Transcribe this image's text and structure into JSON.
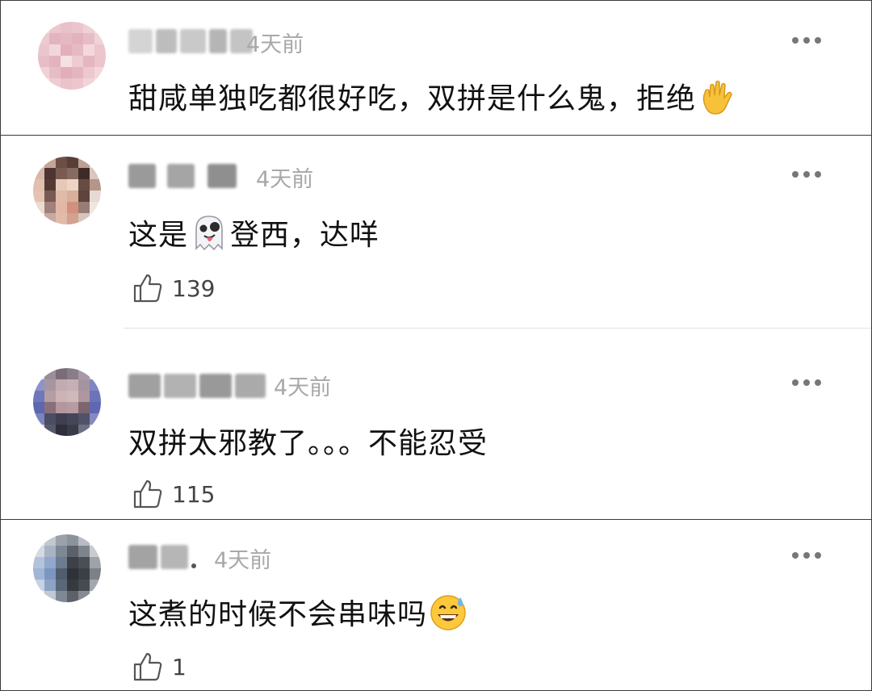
{
  "comments": [
    {
      "time": "4天前",
      "text": "甜咸单独吃都很好吃，双拼是什么鬼，拒绝",
      "emoji": "raised-hand",
      "likes": null
    },
    {
      "time": "4天前",
      "text_before": "这是",
      "emoji": "ghost-tongue",
      "text_after": "登西，达咩",
      "likes": "139"
    },
    {
      "time": "4天前",
      "text": "双拼太邪教了。。。不能忍受",
      "likes": "115"
    },
    {
      "time": "4天前",
      "text": "这煮的时候不会串味吗",
      "emoji": "grinning-sweat",
      "likes": "1"
    }
  ],
  "colors": {
    "border": "#3a3a3a",
    "time": "#a8a8a8",
    "text": "#111111",
    "icon": "#777777"
  }
}
